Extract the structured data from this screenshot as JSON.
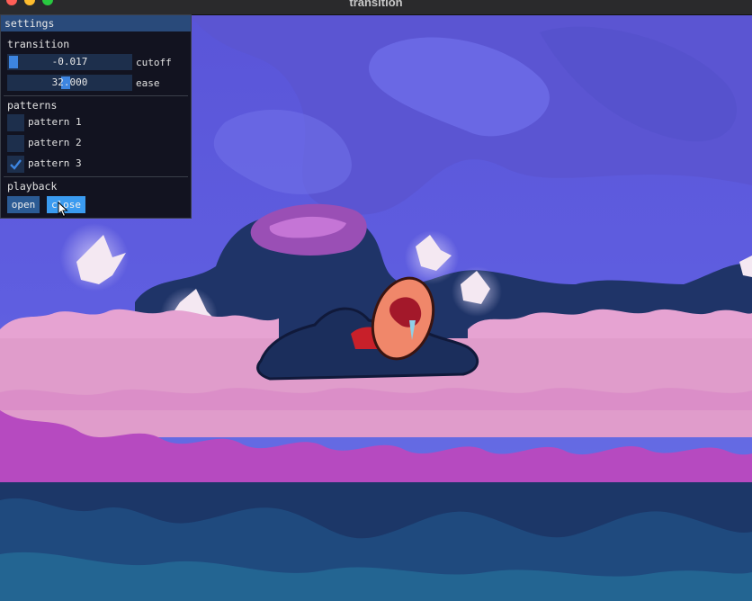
{
  "window": {
    "title": "transition"
  },
  "panel": {
    "title": "settings",
    "transition": {
      "header": "transition",
      "cutoff": {
        "value": "-0.017",
        "label": "cutoff",
        "fill": 0.0
      },
      "ease": {
        "value": "32.000",
        "label": "ease",
        "fill": 0.44
      }
    },
    "patterns": {
      "header": "patterns",
      "items": [
        {
          "label": "pattern 1",
          "checked": false
        },
        {
          "label": "pattern 2",
          "checked": false
        },
        {
          "label": "pattern 3",
          "checked": true
        }
      ]
    },
    "playback": {
      "header": "playback",
      "open_label": "open",
      "close_label": "close"
    }
  },
  "colors": {
    "panel_bg": "#0e0f14",
    "header_bg": "#294a7a",
    "frame_bg": "#1d2f4c",
    "grab": "#3d85e0",
    "button": "#2b5b94",
    "button_active": "#3a9bf0",
    "check": "#3d85e0"
  }
}
